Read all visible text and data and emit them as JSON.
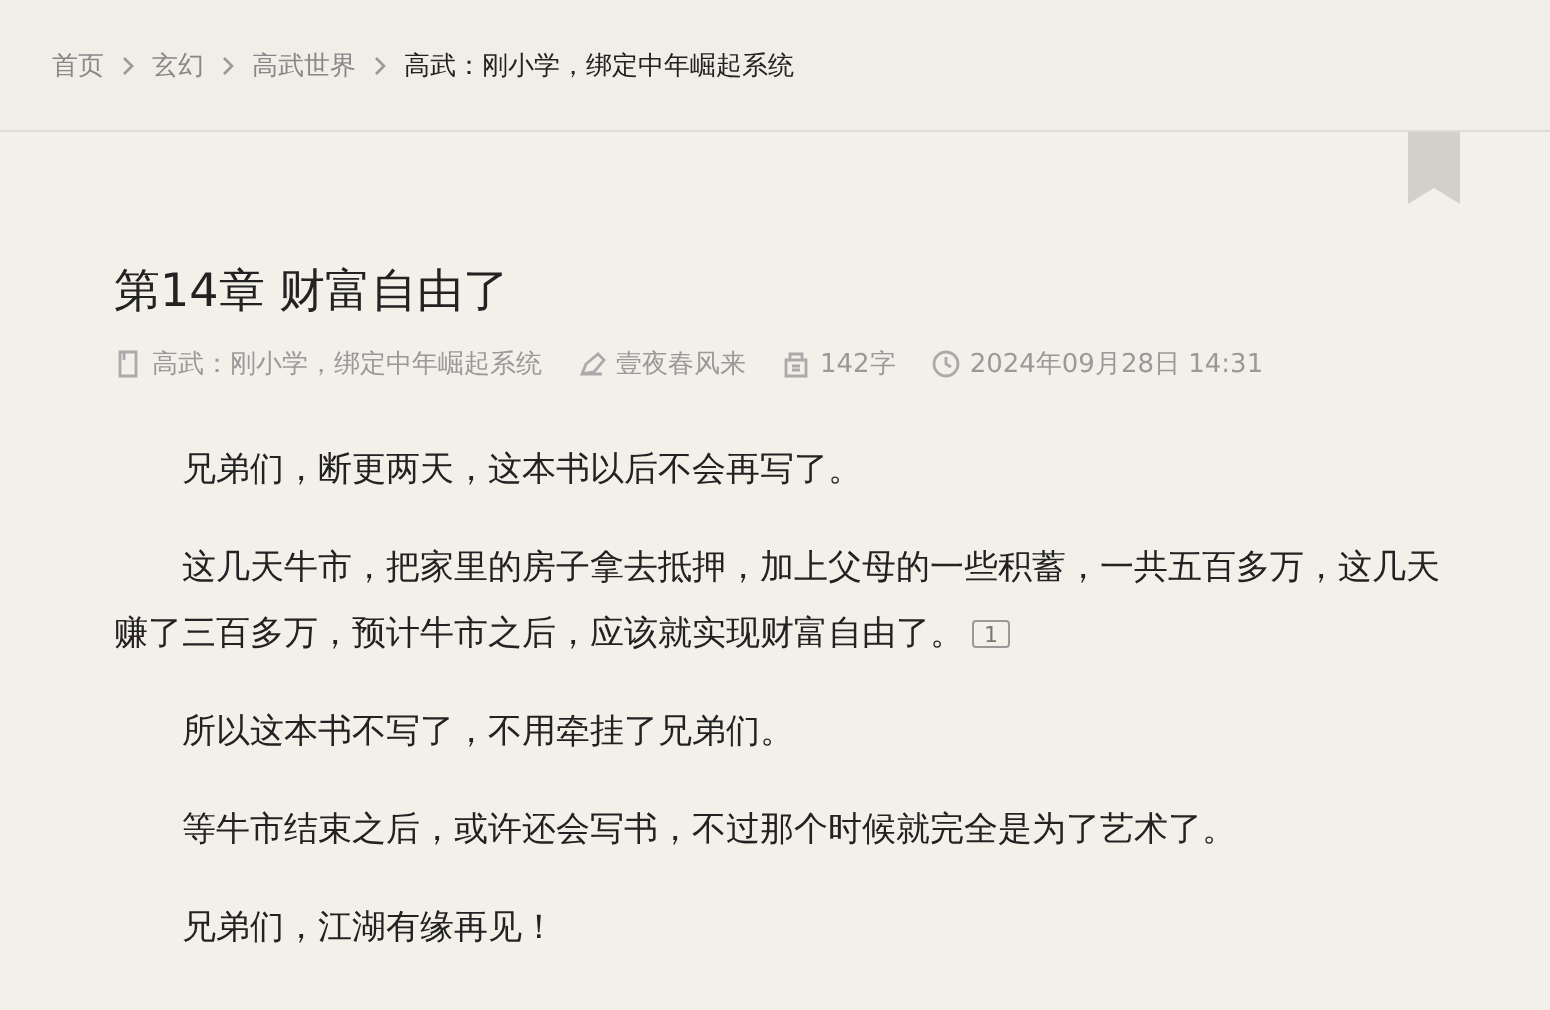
{
  "breadcrumb": [
    {
      "label": "首页",
      "current": false
    },
    {
      "label": "玄幻",
      "current": false
    },
    {
      "label": "高武世界",
      "current": false
    },
    {
      "label": "高武：刚小学，绑定中年崛起系统",
      "current": true
    }
  ],
  "chapter": {
    "title": "第14章 财富自由了",
    "meta": [
      {
        "kind": "book",
        "text": "高武：刚小学，绑定中年崛起系统"
      },
      {
        "kind": "author",
        "text": "壹夜春风来"
      },
      {
        "kind": "words",
        "text": "142字"
      },
      {
        "kind": "time",
        "text": "2024年09月28日 14:31"
      }
    ],
    "paragraphs": [
      {
        "text": "兄弟们，断更两天，这本书以后不会再写了。"
      },
      {
        "text": "这几天牛市，把家里的房子拿去抵押，加上父母的一些积蓄，一共五百多万，这几天赚了三百多万，预计牛市之后，应该就实现财富自由了。",
        "comment_count": "1"
      },
      {
        "text": "所以这本书不写了，不用牵挂了兄弟们。"
      },
      {
        "text": "等牛市结束之后，或许还会写书，不过那个时候就完全是为了艺术了。"
      },
      {
        "text": "兄弟们，江湖有缘再见！"
      }
    ]
  }
}
